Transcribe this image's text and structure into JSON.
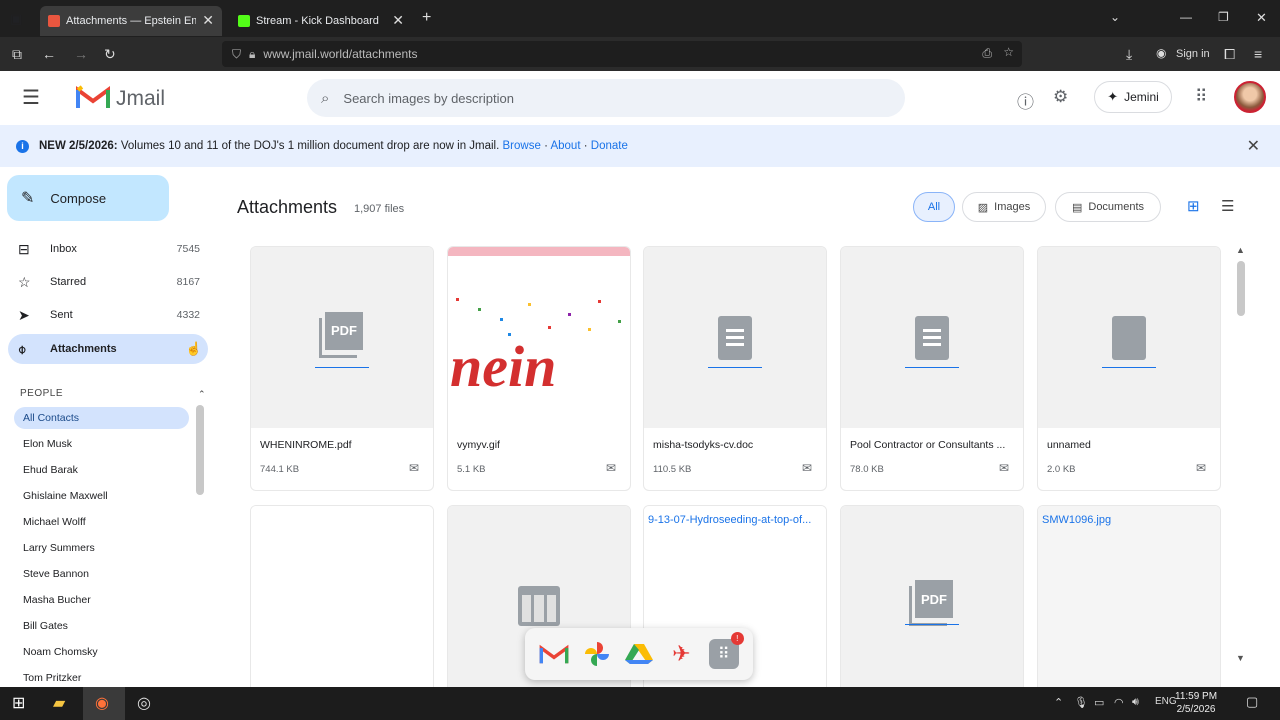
{
  "browser": {
    "tabs": [
      {
        "title": "Attachments — Epstein Emails",
        "active": true
      },
      {
        "title": "Stream - Kick Dashboard",
        "active": false
      }
    ],
    "url": "www.jmail.world/attachments",
    "signin_label": "Sign in"
  },
  "header": {
    "app_name": "Jmail",
    "search_placeholder": "Search images by description",
    "assistant_label": "Jemini"
  },
  "banner": {
    "headline": "NEW 2/5/2026:",
    "message": "Volumes 10 and 11 of the DOJ's 1 million document drop are now in Jmail.",
    "links": [
      "Browse",
      "About",
      "Donate"
    ]
  },
  "sidebar": {
    "compose_label": "Compose",
    "items": [
      {
        "label": "Inbox",
        "count": "7545",
        "icon": "inbox-icon"
      },
      {
        "label": "Starred",
        "count": "8167",
        "icon": "star-icon"
      },
      {
        "label": "Sent",
        "count": "4332",
        "icon": "send-icon"
      },
      {
        "label": "Attachments",
        "count": "",
        "icon": "paperclip-icon"
      }
    ],
    "people_header": "PEOPLE",
    "contacts": [
      "All Contacts",
      "Elon Musk",
      "Ehud Barak",
      "Ghislaine Maxwell",
      "Michael Wolff",
      "Larry Summers",
      "Steve Bannon",
      "Masha Bucher",
      "Bill Gates",
      "Noam Chomsky",
      "Tom Pritzker"
    ]
  },
  "main": {
    "title": "Attachments",
    "count": "1,907 files",
    "filters": [
      "All",
      "Images",
      "Documents"
    ],
    "files": [
      {
        "name": "WHENINROME.pdf",
        "size": "744.1 KB",
        "kind": "pdf"
      },
      {
        "name": "vymyv.gif",
        "size": "5.1 KB",
        "kind": "image"
      },
      {
        "name": "misha-tsodyks-cv.doc",
        "size": "110.5 KB",
        "kind": "doc"
      },
      {
        "name": "Pool Contractor or Consultants ...",
        "size": "78.0 KB",
        "kind": "doc"
      },
      {
        "name": "unnamed",
        "size": "2.0 KB",
        "kind": "file"
      },
      {
        "name": "",
        "size": "",
        "kind": "blank"
      },
      {
        "name": "",
        "size": "",
        "kind": "sheet"
      },
      {
        "name": "9-13-07-Hydroseeding-at-top-of...",
        "size": "",
        "kind": "link"
      },
      {
        "name": "",
        "size": "",
        "kind": "pdf"
      },
      {
        "name": "SMW1096.jpg",
        "size": "",
        "kind": "link"
      }
    ],
    "gif_text": "nein"
  },
  "taskbar": {
    "lang": "ENG",
    "time": "11:59 PM",
    "date": "2/5/2026"
  },
  "colors": {
    "accent": "#1a73e8",
    "compose_bg": "#c2e7ff",
    "active_nav": "#d3e3fd",
    "banner_bg": "#e8f0fe"
  }
}
